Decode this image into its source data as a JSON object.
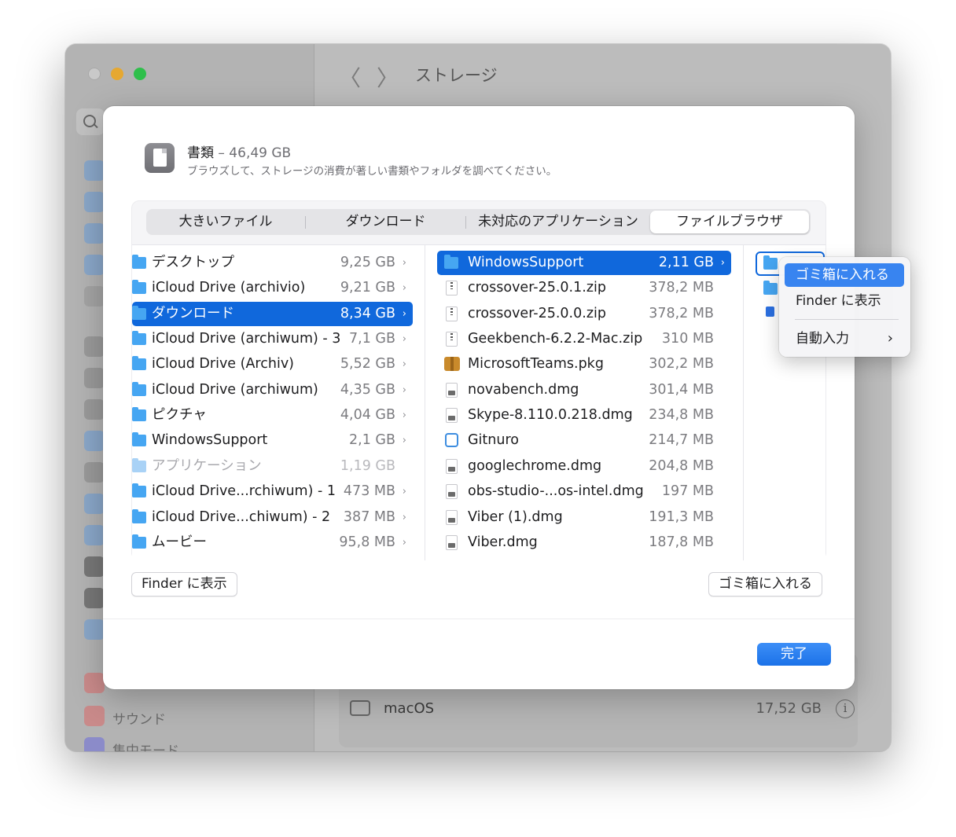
{
  "window": {
    "title": "ストレージ",
    "back_arrow": "〈",
    "forward_arrow": "〉",
    "sidebar_items": [
      "サウンド",
      "集中モード"
    ],
    "macos_row": {
      "label": "macOS",
      "size": "17,52 GB",
      "info": "i"
    }
  },
  "sheet": {
    "category": "書類",
    "size": "– 46,49 GB",
    "subtitle": "ブラウズして、ストレージの消費が著しい書類やフォルダを調べてください。",
    "tabs": [
      "大きいファイル",
      "ダウンロード",
      "未対応のアプリケーション",
      "ファイルブラウザ"
    ],
    "active_tab": "ファイルブラウザ",
    "column1": [
      {
        "name": "デスクトップ",
        "size": "9,25 GB"
      },
      {
        "name": "iCloud Drive (archivio)",
        "size": "9,21 GB"
      },
      {
        "name": "ダウンロード",
        "size": "8,34 GB"
      },
      {
        "name": "iCloud Drive (archiwum) - 3",
        "size": "7,1 GB"
      },
      {
        "name": "iCloud Drive (Archiv)",
        "size": "5,52 GB"
      },
      {
        "name": "iCloud Drive (archiwum)",
        "size": "4,35 GB"
      },
      {
        "name": "ピクチャ",
        "size": "4,04 GB"
      },
      {
        "name": "WindowsSupport",
        "size": "2,1 GB"
      },
      {
        "name": "アプリケーション",
        "size": "1,19 GB"
      },
      {
        "name": "iCloud Drive...rchiwum) - 1",
        "size": "473 MB"
      },
      {
        "name": "iCloud Drive...chiwum) - 2",
        "size": "387 MB"
      },
      {
        "name": "ムービー",
        "size": "95,8 MB"
      }
    ],
    "column2": [
      {
        "name": "WindowsSupport",
        "size": "2,11 GB"
      },
      {
        "name": "crossover-25.0.1.zip",
        "size": "378,2 MB"
      },
      {
        "name": "crossover-25.0.0.zip",
        "size": "378,2 MB"
      },
      {
        "name": "Geekbench-6.2.2-Mac.zip",
        "size": "310 MB"
      },
      {
        "name": "MicrosoftTeams.pkg",
        "size": "302,2 MB"
      },
      {
        "name": "novabench.dmg",
        "size": "301,4 MB"
      },
      {
        "name": "Skype-8.110.0.218.dmg",
        "size": "234,8 MB"
      },
      {
        "name": "Gitnuro",
        "size": "214,7 MB"
      },
      {
        "name": "googlechrome.dmg",
        "size": "204,8 MB"
      },
      {
        "name": "obs-studio-...os-intel.dmg",
        "size": "197 MB"
      },
      {
        "name": "Viber (1).dmg",
        "size": "191,3 MB"
      },
      {
        "name": "Viber.dmg",
        "size": "187,8 MB"
      }
    ],
    "buttons": {
      "show_in_finder": "Finder に表示",
      "move_to_trash": "ゴミ箱に入れる",
      "done": "完了"
    }
  },
  "context_menu": {
    "items": [
      "ゴミ箱に入れる",
      "Finder に表示",
      "自動入力"
    ],
    "submenu_arrow": "›"
  },
  "colors": {
    "accent": "#1068dc",
    "folder": "#46a6f2",
    "primary_button": "#1b72e8"
  }
}
